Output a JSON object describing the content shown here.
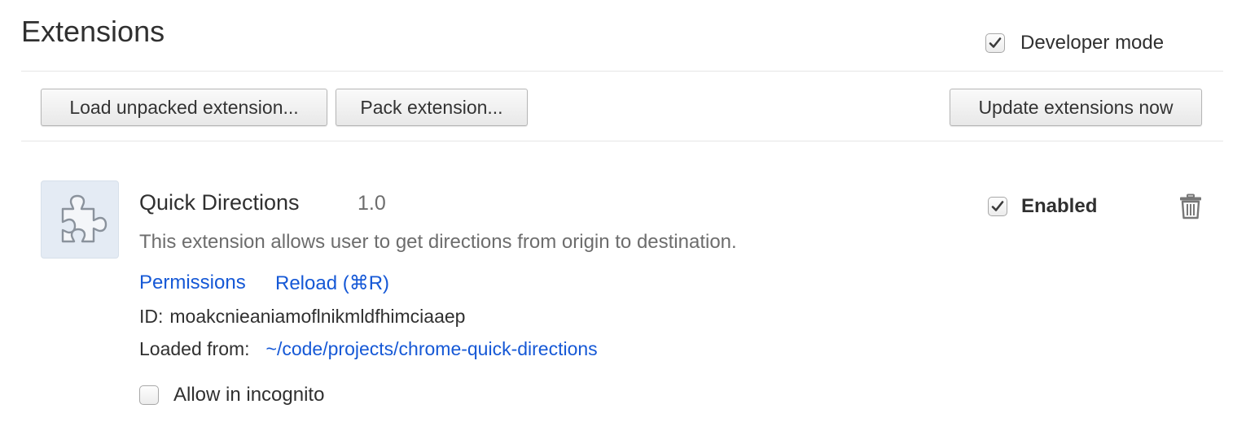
{
  "header": {
    "title": "Extensions",
    "developer_mode": {
      "label": "Developer mode",
      "checked": true
    }
  },
  "toolbar": {
    "load_unpacked_label": "Load unpacked extension...",
    "pack_label": "Pack extension...",
    "update_label": "Update extensions now"
  },
  "extension": {
    "icon": "puzzle-piece-icon",
    "name": "Quick Directions",
    "version": "1.0",
    "description": "This extension allows user to get directions from origin to destination.",
    "links": {
      "permissions": "Permissions",
      "reload": "Reload (⌘R)"
    },
    "id_label": "ID:",
    "id_value": "moakcnieaniamoflnikmldfhimciaaep",
    "loaded_from_label": "Loaded from:",
    "loaded_from_path": "~/code/projects/chrome-quick-directions",
    "incognito": {
      "label": "Allow in incognito",
      "checked": false
    },
    "enabled": {
      "label": "Enabled",
      "checked": true
    },
    "remove_icon": "trash-icon"
  },
  "colors": {
    "link": "#1558d6",
    "text": "#303030",
    "muted": "#6d6d6d",
    "divider": "#e6e6e6"
  }
}
